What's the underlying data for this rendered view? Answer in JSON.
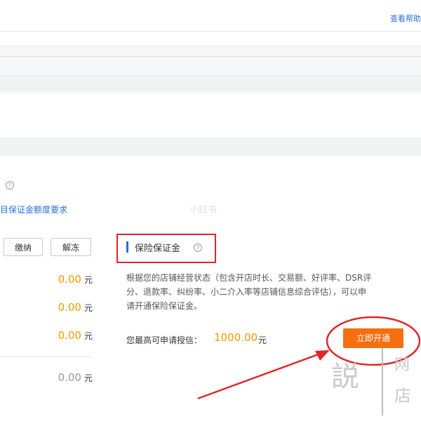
{
  "header": {
    "help_link": "查看帮助"
  },
  "left": {
    "help_symbol": "?",
    "requirement_link": "目保证金额度要求",
    "pay_button": "缴纳",
    "release_button": "解冻",
    "amounts": [
      {
        "value": "0.00",
        "unit": "元"
      },
      {
        "value": "0.00",
        "unit": "元"
      },
      {
        "value": "0.00",
        "unit": "元"
      }
    ],
    "total": {
      "value": "0.00",
      "unit": "元"
    }
  },
  "watermark": {
    "center": "小红书"
  },
  "insurance": {
    "title": "保险保证金",
    "help_symbol": "?",
    "description": [
      "根据您的店铺经营状态（包含开店时长、交易额、好评率、DSR评",
      "分、退款率、纠纷率、小二介入率等店铺信息综合评估），可以申",
      "请开通保险保证金。"
    ],
    "credit_label": "您最高可申请授信：",
    "credit_amount": "1000.00",
    "credit_unit": "元",
    "open_button": "立即开通"
  },
  "corner_watermark": {
    "char1": "説",
    "char2": "网",
    "char3": "店"
  },
  "colors": {
    "accent_orange": "#f39800",
    "button_orange": "#f56f10",
    "link_blue": "#2a6fd6",
    "annotation_red": "#e0262b"
  },
  "icons": {
    "help": "question-circle-icon",
    "annotation": "red-circle-arrow-annotation"
  }
}
